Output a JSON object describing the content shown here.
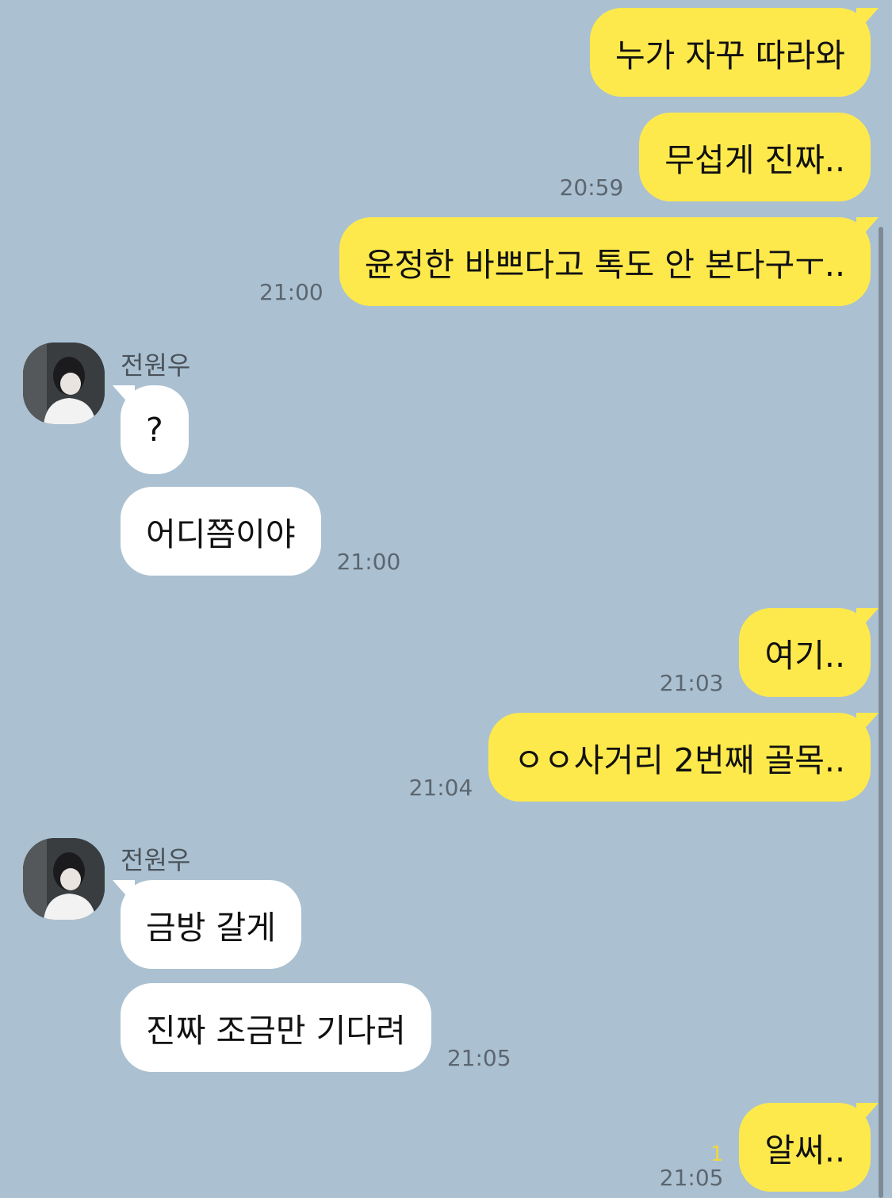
{
  "contact": {
    "name": "전원우",
    "avatar_icon": "profile-photo"
  },
  "colors": {
    "background": "#abc1d1",
    "my_bubble": "#fee94c",
    "their_bubble": "#ffffff",
    "unread": "#f0d93a"
  },
  "messages": [
    {
      "from": "me",
      "text": "누가 자꾸 따라와",
      "time": ""
    },
    {
      "from": "me",
      "text": "무섭게 진짜..",
      "time": "20:59"
    },
    {
      "from": "me",
      "text": "윤정한 바쁘다고 톡도 안 본다구ㅜ..",
      "time": "21:00"
    },
    {
      "from": "other",
      "text": "?",
      "time": ""
    },
    {
      "from": "other",
      "text": "어디쯤이야",
      "time": "21:00"
    },
    {
      "from": "me",
      "text": "여기..",
      "time": "21:03"
    },
    {
      "from": "me",
      "text": "ㅇㅇ사거리 2번째 골목..",
      "time": "21:04"
    },
    {
      "from": "other",
      "text": "금방 갈게",
      "time": ""
    },
    {
      "from": "other",
      "text": "진짜 조금만 기다려",
      "time": "21:05"
    },
    {
      "from": "me",
      "text": "알써..",
      "time": "21:05",
      "unread": "1"
    }
  ]
}
